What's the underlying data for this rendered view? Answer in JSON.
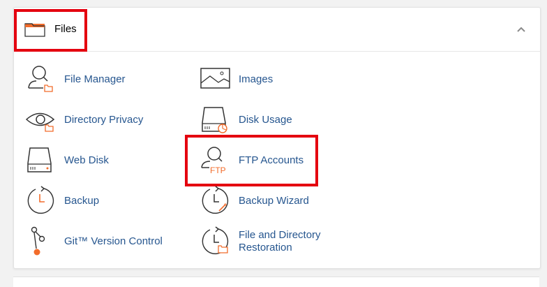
{
  "section": {
    "title": "Files",
    "collapse_icon": "chevron-up-icon"
  },
  "items": [
    {
      "label": "File Manager",
      "icon": "file-manager-icon"
    },
    {
      "label": "Images",
      "icon": "images-icon"
    },
    {
      "label": "Directory Privacy",
      "icon": "directory-privacy-icon"
    },
    {
      "label": "Disk Usage",
      "icon": "disk-usage-icon"
    },
    {
      "label": "Web Disk",
      "icon": "web-disk-icon"
    },
    {
      "label": "FTP Accounts",
      "icon": "ftp-accounts-icon",
      "icon_text": "FTP"
    },
    {
      "label": "Backup",
      "icon": "backup-icon"
    },
    {
      "label": "Backup Wizard",
      "icon": "backup-wizard-icon"
    },
    {
      "label": "Git™ Version Control",
      "icon": "git-version-control-icon"
    },
    {
      "label_line1": "File and Directory",
      "label_line2": "Restoration",
      "icon": "file-restoration-icon"
    }
  ],
  "colors": {
    "link": "#26568f",
    "accent": "#f26c2b",
    "highlight": "#e4000f"
  }
}
